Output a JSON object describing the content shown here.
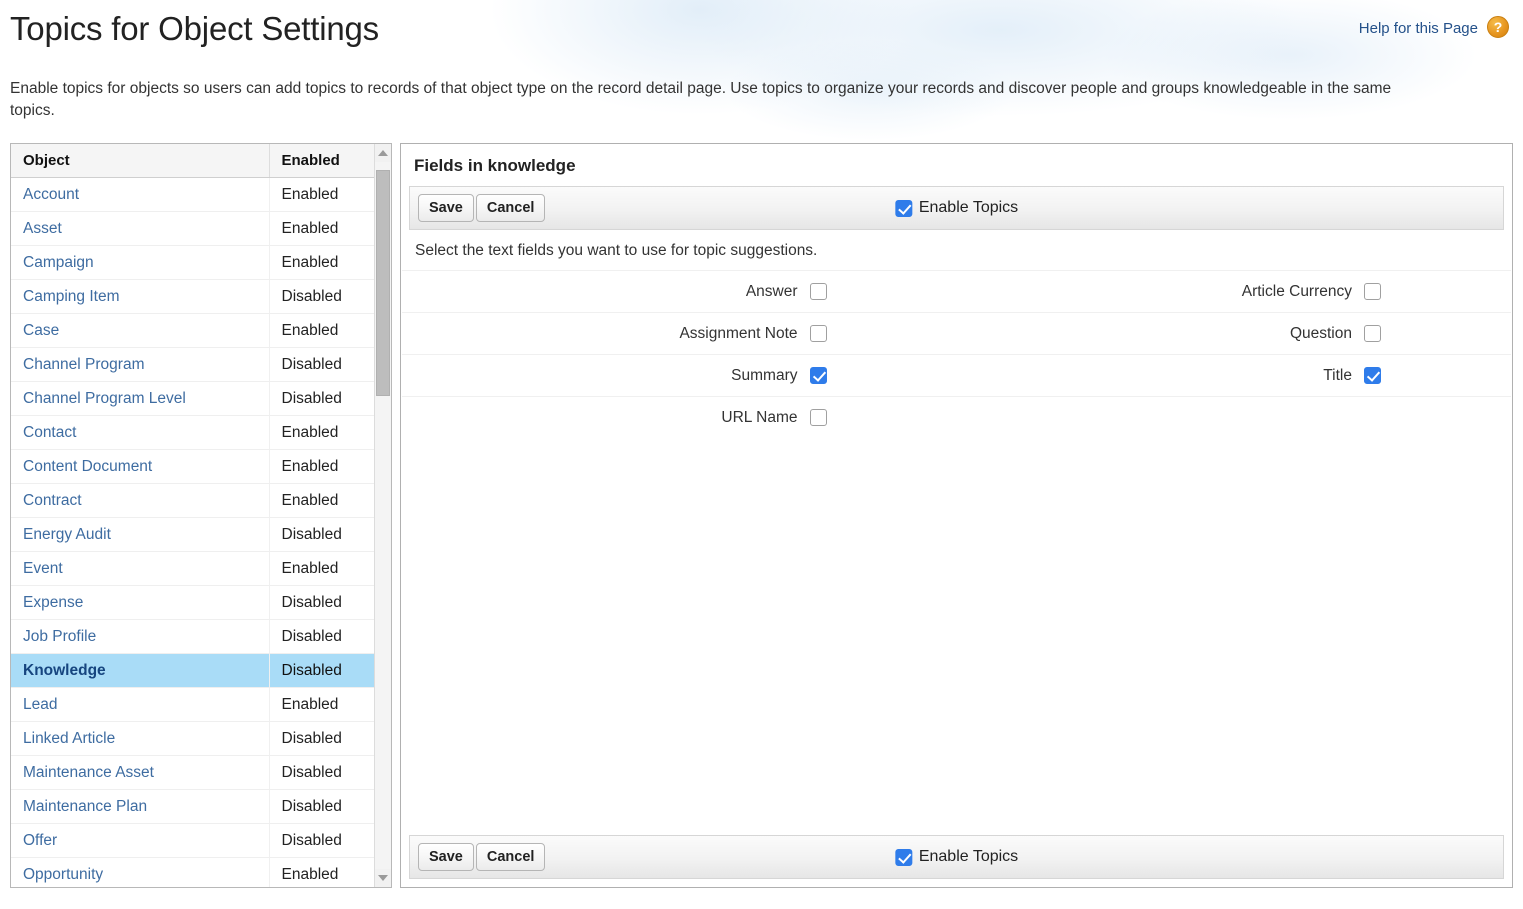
{
  "page": {
    "title": "Topics for Object Settings",
    "description": "Enable topics for objects so users can add topics to records of that object type on the record detail page. Use topics to organize your records and discover people and groups knowledgeable in the same topics.",
    "help_link": "Help for this Page",
    "help_icon": "question-mark-icon"
  },
  "object_table": {
    "columns": [
      "Object",
      "Enabled"
    ],
    "selected": "Knowledge",
    "rows": [
      {
        "object": "Account",
        "status": "Enabled"
      },
      {
        "object": "Asset",
        "status": "Enabled"
      },
      {
        "object": "Campaign",
        "status": "Enabled"
      },
      {
        "object": "Camping Item",
        "status": "Disabled"
      },
      {
        "object": "Case",
        "status": "Enabled"
      },
      {
        "object": "Channel Program",
        "status": "Disabled"
      },
      {
        "object": "Channel Program Level",
        "status": "Disabled"
      },
      {
        "object": "Contact",
        "status": "Enabled"
      },
      {
        "object": "Content Document",
        "status": "Enabled"
      },
      {
        "object": "Contract",
        "status": "Enabled"
      },
      {
        "object": "Energy Audit",
        "status": "Disabled"
      },
      {
        "object": "Event",
        "status": "Enabled"
      },
      {
        "object": "Expense",
        "status": "Disabled"
      },
      {
        "object": "Job Profile",
        "status": "Disabled"
      },
      {
        "object": "Knowledge",
        "status": "Disabled"
      },
      {
        "object": "Lead",
        "status": "Enabled"
      },
      {
        "object": "Linked Article",
        "status": "Disabled"
      },
      {
        "object": "Maintenance Asset",
        "status": "Disabled"
      },
      {
        "object": "Maintenance Plan",
        "status": "Disabled"
      },
      {
        "object": "Offer",
        "status": "Disabled"
      },
      {
        "object": "Opportunity",
        "status": "Enabled"
      }
    ]
  },
  "fields_panel": {
    "title": "Fields in knowledge",
    "hint": "Select the text fields you want to use for topic suggestions.",
    "save_label": "Save",
    "cancel_label": "Cancel",
    "enable_topics_label": "Enable Topics",
    "enable_topics_checked": true,
    "field_rows": [
      [
        {
          "label": "Answer",
          "checked": false
        },
        {
          "label": "Article Currency",
          "checked": false
        }
      ],
      [
        {
          "label": "Assignment Note",
          "checked": false
        },
        {
          "label": "Question",
          "checked": false
        }
      ],
      [
        {
          "label": "Summary",
          "checked": true
        },
        {
          "label": "Title",
          "checked": true
        }
      ],
      [
        {
          "label": "URL Name",
          "checked": false
        },
        null
      ]
    ]
  },
  "colors": {
    "accent_blue": "#2f7cea",
    "link_blue": "#3e6ca1",
    "selected_row": "#a9dcf7",
    "help_orange": "#e6941f"
  }
}
